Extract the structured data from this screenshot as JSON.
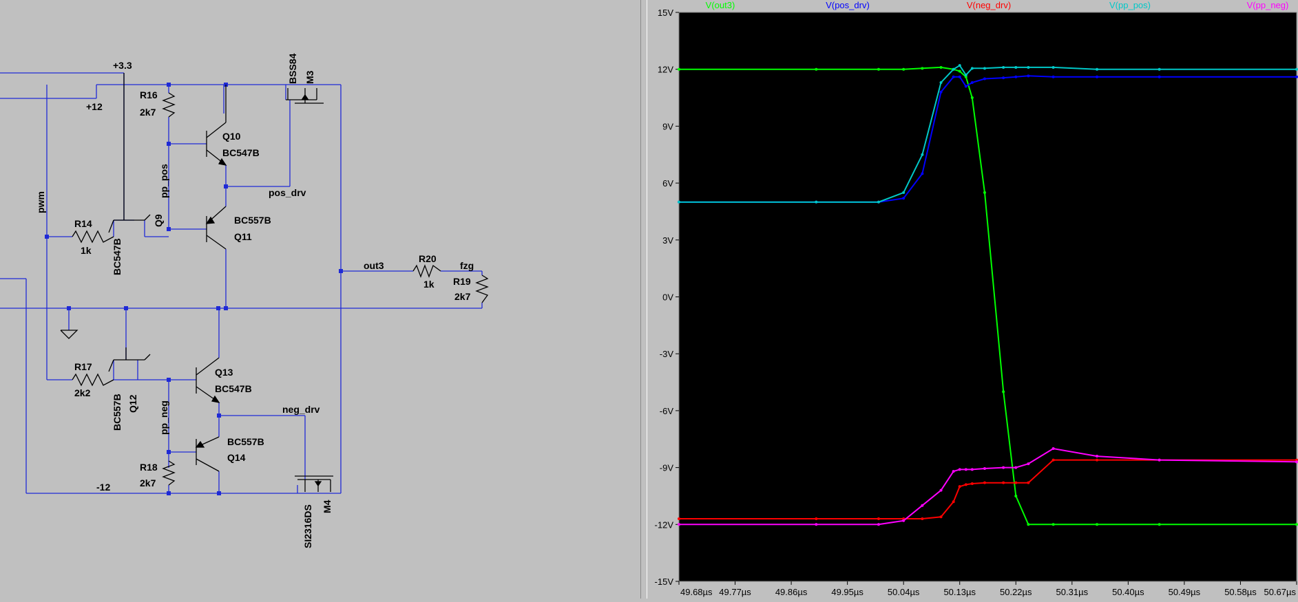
{
  "schematic": {
    "wire_color": "#1f2ad6",
    "component_color": "#000000",
    "background": "#c0c0c0",
    "components": [
      {
        "ref": "R16",
        "value": "2k7"
      },
      {
        "ref": "Q10",
        "value": "BC547B"
      },
      {
        "ref": "Q11",
        "value": "BC557B"
      },
      {
        "ref": "Q9",
        "value": "BC547B"
      },
      {
        "ref": "R14",
        "value": "1k"
      },
      {
        "ref": "M3",
        "value": "BSS84"
      },
      {
        "ref": "R20",
        "value": "1k"
      },
      {
        "ref": "R19",
        "value": "2k7"
      },
      {
        "ref": "R17",
        "value": "2k2"
      },
      {
        "ref": "Q12",
        "value": "BC557B"
      },
      {
        "ref": "Q13",
        "value": "BC547B"
      },
      {
        "ref": "Q14",
        "value": "BC557B"
      },
      {
        "ref": "R18",
        "value": "2k7"
      },
      {
        "ref": "M4",
        "value": "SI2316DS"
      }
    ],
    "nets": {
      "v33": "+3.3",
      "v12": "+12",
      "vm12": "-12",
      "pwm": "pwm",
      "pp_pos": "pp_pos",
      "pos_drv": "pos_drv",
      "out3": "out3",
      "fzg": "fzg",
      "pp_neg": "pp_neg",
      "neg_drv": "neg_drv"
    }
  },
  "plot": {
    "background": "#000000",
    "legend": [
      {
        "label": "V(out3)",
        "color": "#00ff00"
      },
      {
        "label": "V(pos_drv)",
        "color": "#0000ff"
      },
      {
        "label": "V(neg_drv)",
        "color": "#ff0000"
      },
      {
        "label": "V(pp_pos)",
        "color": "#00c8c8"
      },
      {
        "label": "V(pp_neg)",
        "color": "#ff00ff"
      }
    ]
  },
  "chart_data": {
    "type": "line",
    "x": [
      49.68,
      49.9,
      50.0,
      50.04,
      50.07,
      50.1,
      50.12,
      50.13,
      50.14,
      50.15,
      50.17,
      50.2,
      50.22,
      50.24,
      50.28,
      50.35,
      50.45,
      50.67
    ],
    "series": [
      {
        "name": "V(out3)",
        "values": [
          12.0,
          12.0,
          12.0,
          12.0,
          12.05,
          12.1,
          12.0,
          11.9,
          11.6,
          10.5,
          5.5,
          -5.0,
          -10.5,
          -12.0,
          -12.0,
          -12.0,
          -12.0,
          -12.0
        ]
      },
      {
        "name": "V(pos_drv)",
        "values": [
          5.0,
          5.0,
          5.0,
          5.2,
          6.5,
          10.8,
          11.6,
          11.6,
          11.1,
          11.3,
          11.5,
          11.55,
          11.6,
          11.65,
          11.6,
          11.6,
          11.6,
          11.6
        ]
      },
      {
        "name": "V(neg_drv)",
        "values": [
          -11.7,
          -11.7,
          -11.7,
          -11.7,
          -11.7,
          -11.6,
          -10.8,
          -10.0,
          -9.9,
          -9.85,
          -9.8,
          -9.8,
          -9.8,
          -9.8,
          -8.6,
          -8.6,
          -8.6,
          -8.6
        ]
      },
      {
        "name": "V(pp_pos)",
        "values": [
          5.0,
          5.0,
          5.0,
          5.5,
          7.5,
          11.3,
          12.0,
          12.2,
          11.7,
          12.05,
          12.05,
          12.1,
          12.1,
          12.1,
          12.1,
          12.0,
          12.0,
          12.0
        ]
      },
      {
        "name": "V(pp_neg)",
        "values": [
          -12.0,
          -12.0,
          -12.0,
          -11.8,
          -11.0,
          -10.2,
          -9.2,
          -9.1,
          -9.1,
          -9.1,
          -9.05,
          -9.0,
          -9.0,
          -8.8,
          -8.0,
          -8.4,
          -8.6,
          -8.7
        ]
      }
    ],
    "xlabel": "",
    "ylabel": "",
    "xlim": [
      49.68,
      50.67
    ],
    "ylim": [
      -15,
      15
    ],
    "x_ticks": [
      "49.68µs",
      "49.77µs",
      "49.86µs",
      "49.95µs",
      "50.04µs",
      "50.13µs",
      "50.22µs",
      "50.31µs",
      "50.40µs",
      "50.49µs",
      "50.58µs",
      "50.67µs"
    ],
    "y_ticks": [
      "15V",
      "12V",
      "9V",
      "6V",
      "3V",
      "0V",
      "-3V",
      "-6V",
      "-9V",
      "-12V",
      "-15V"
    ],
    "grid": false
  }
}
